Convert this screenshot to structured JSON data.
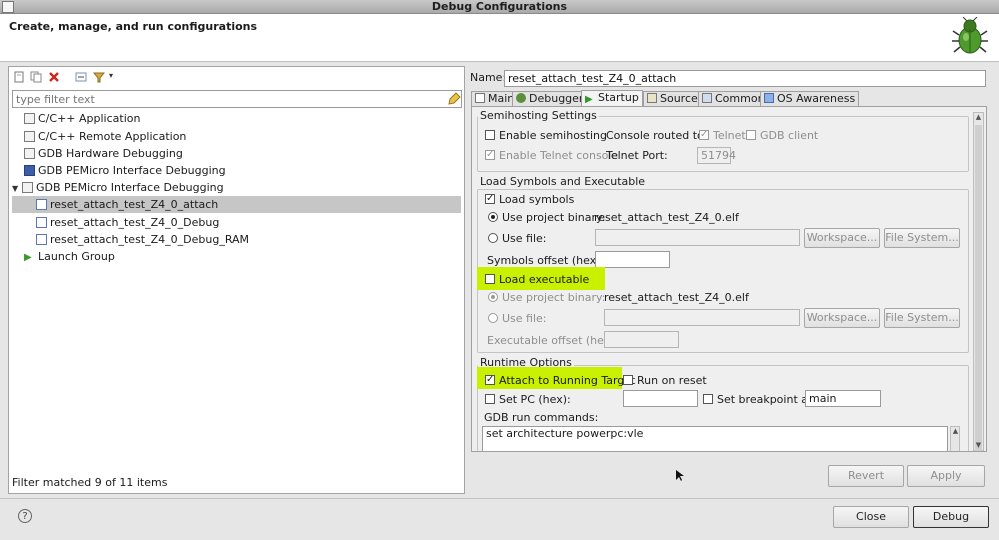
{
  "window": {
    "title": "Debug Configurations"
  },
  "header": {
    "subtitle": "Create, manage, and run configurations",
    "bug_icon": "bug-icon"
  },
  "left_panel": {
    "toolbar_icons": [
      "new-config-icon",
      "duplicate-icon",
      "delete-icon",
      "collapse-all-icon",
      "filter-icon",
      "dropdown-icon"
    ],
    "filter_placeholder": "type filter text",
    "tree": [
      {
        "label": "C/C++ Application",
        "icon": "c-app-icon",
        "level": 0
      },
      {
        "label": "C/C++ Remote Application",
        "icon": "c-app-icon",
        "level": 0
      },
      {
        "label": "GDB Hardware Debugging",
        "icon": "c-app-icon",
        "level": 0
      },
      {
        "label": "GDB PEMicro Interface Debugging",
        "icon": "pemicro-icon",
        "level": 0
      },
      {
        "label": "GDB PEMicro Interface Debugging",
        "icon": "c-app-icon",
        "level": 0,
        "expanded": true
      },
      {
        "label": "reset_attach_test_Z4_0_attach",
        "icon": "config-icon",
        "level": 1,
        "selected": true
      },
      {
        "label": "reset_attach_test_Z4_0_Debug",
        "icon": "config-icon",
        "level": 1
      },
      {
        "label": "reset_attach_test_Z4_0_Debug_RAM",
        "icon": "config-icon",
        "level": 1
      },
      {
        "label": "Launch Group",
        "icon": "launch-group-icon",
        "level": 0
      }
    ],
    "filter_status": "Filter matched 9 of 11 items"
  },
  "right_panel": {
    "name_label": "Name:",
    "name_value": "reset_attach_test_Z4_0_attach",
    "tabs": [
      {
        "label": "Main",
        "icon": "main-tab-icon"
      },
      {
        "label": "Debugger",
        "icon": "debugger-tab-icon"
      },
      {
        "label": "Startup",
        "icon": "startup-tab-icon",
        "active": true
      },
      {
        "label": "Source",
        "icon": "source-tab-icon"
      },
      {
        "label": "Common",
        "icon": "common-tab-icon"
      },
      {
        "label": "OS Awareness",
        "icon": "os-awareness-tab-icon"
      }
    ],
    "semihosting": {
      "title": "Semihosting Settings",
      "enable_semihosting": "Enable semihosting",
      "console_routed_to": "Console routed to:",
      "telnet": "Telnet",
      "gdb_client": "GDB client",
      "enable_telnet_console": "Enable Telnet console",
      "telnet_port_label": "Telnet Port:",
      "telnet_port_value": "51794"
    },
    "load_symbols": {
      "title": "Load Symbols and Executable",
      "load_symbols": "Load symbols",
      "use_project_binary": "Use project binary:",
      "project_binary_value": "reset_attach_test_Z4_0.elf",
      "use_file": "Use file:",
      "workspace_button": "Workspace...",
      "file_system_button": "File System...",
      "symbols_offset": "Symbols offset (hex):",
      "load_executable": "Load executable",
      "exe_use_project_binary": "Use project binary:",
      "exe_project_binary_value": "reset_attach_test_Z4_0.elf",
      "exe_use_file": "Use file:",
      "exe_workspace_button": "Workspace...",
      "exe_file_system_button": "File System...",
      "executable_offset": "Executable offset (hex):"
    },
    "runtime": {
      "title": "Runtime Options",
      "attach_to_running_target": "Attach to Running Target",
      "run_on_reset": "Run on reset",
      "set_pc": "Set PC (hex):",
      "set_breakpoint_at": "Set breakpoint at:",
      "breakpoint_value": "main",
      "gdb_run_commands": "GDB run commands:",
      "commands_value": "set architecture powerpc:vle"
    },
    "revert_button": "Revert",
    "apply_button": "Apply"
  },
  "footer": {
    "help_icon": "help-icon",
    "help_glyph": "?",
    "close_button": "Close",
    "debug_button": "Debug"
  },
  "colors": {
    "highlight": "#c8f000",
    "selected_row": "#c6c6c6"
  }
}
